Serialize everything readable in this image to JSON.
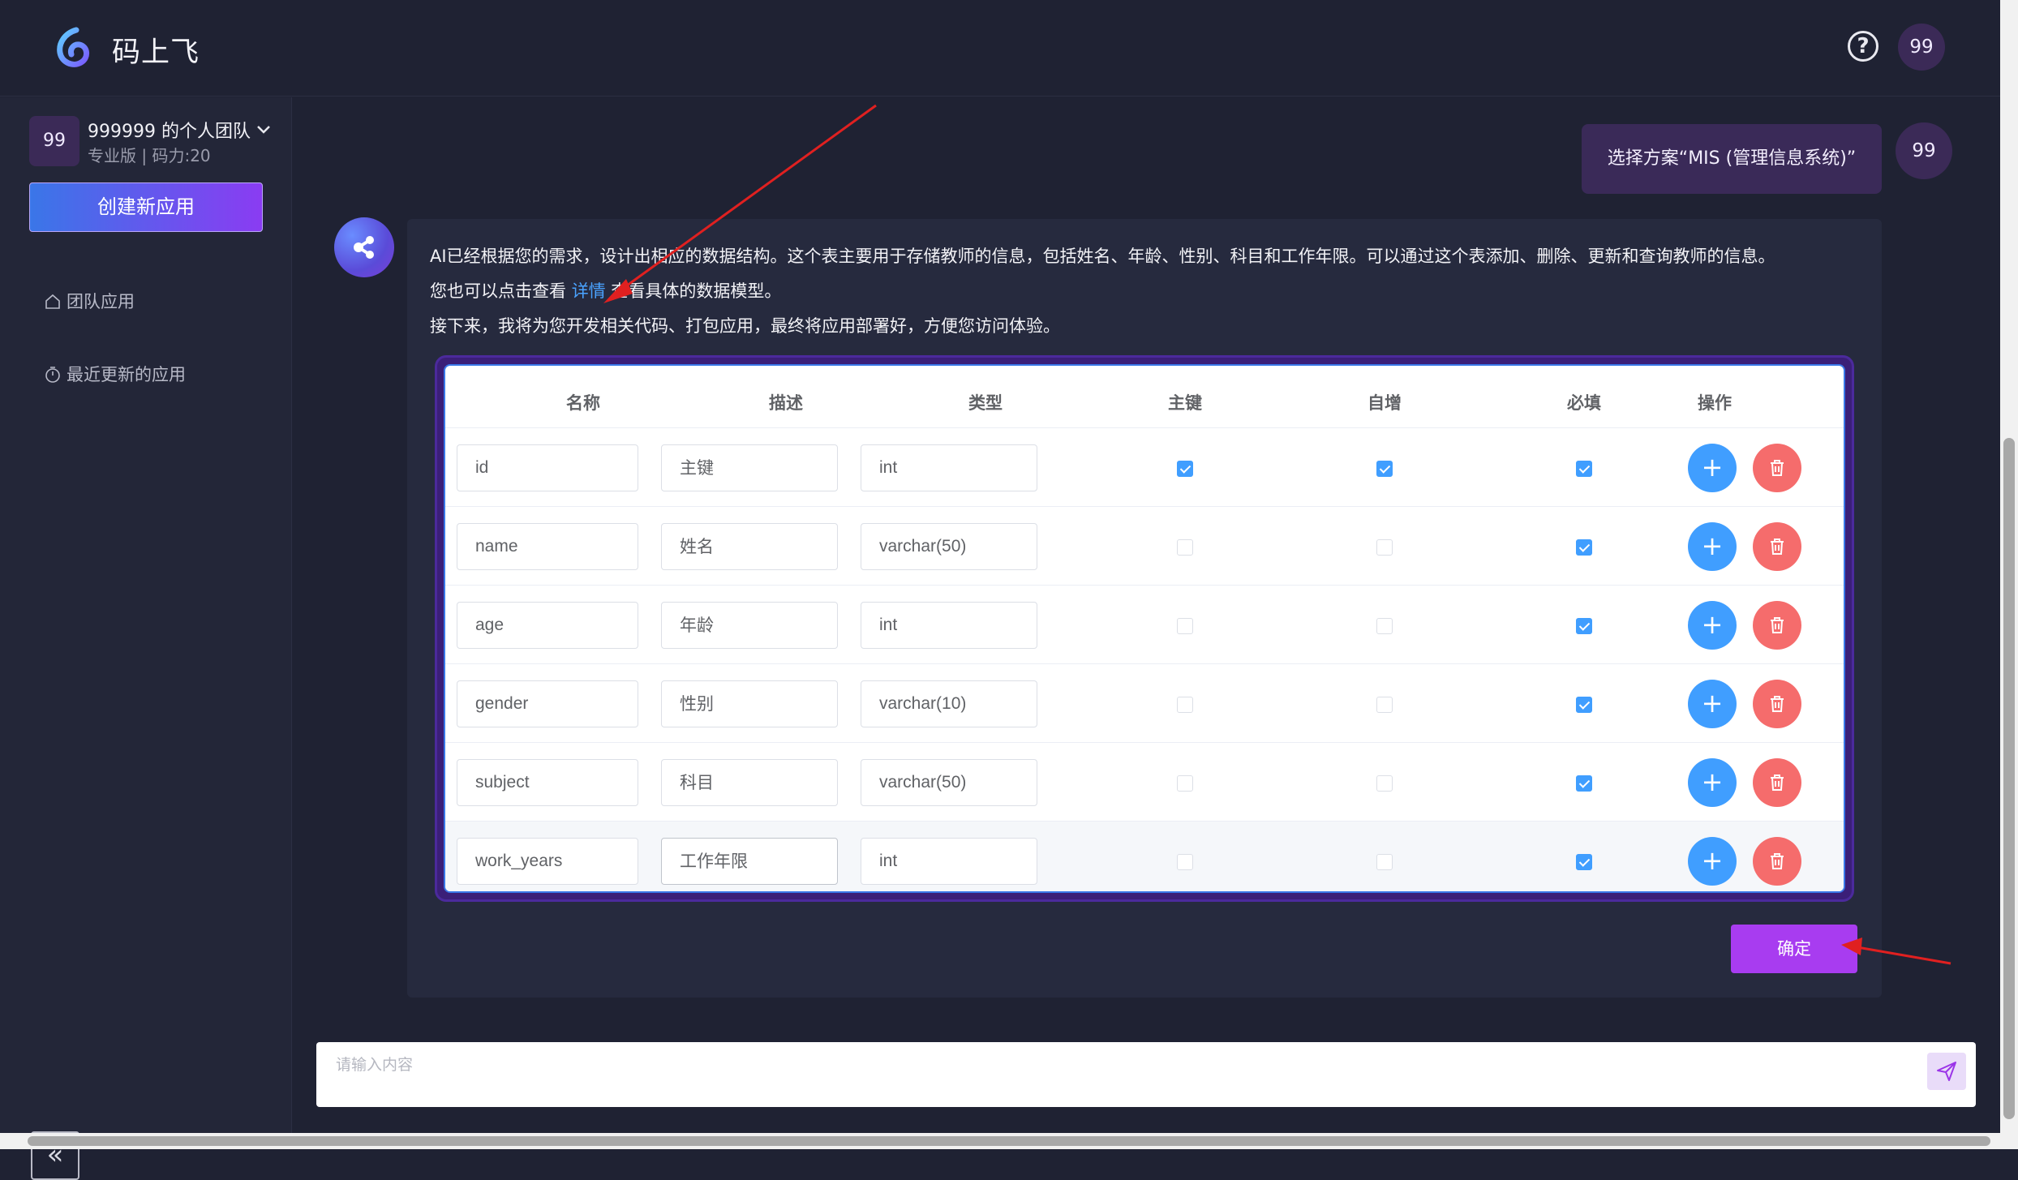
{
  "header": {
    "app_name": "码上飞",
    "help_icon": "question-circle-icon",
    "avatar_text": "99"
  },
  "sidebar": {
    "team": {
      "avatar_text": "99",
      "name": "999999 的个人团队",
      "subtitle": "专业版 | 码力:20"
    },
    "create_button": "创建新应用",
    "nav": [
      {
        "icon": "home-icon",
        "label": "团队应用"
      },
      {
        "icon": "stopwatch-icon",
        "label": "最近更新的应用"
      }
    ],
    "collapse_icon": "double-chevron-left-icon",
    "collapse_glyph": "«"
  },
  "chat": {
    "user_message": "选择方案“MIS (管理信息系统)”",
    "user_avatar": "99",
    "ai_line1": "AI已经根据您的需求，设计出相应的数据结构。这个表主要用于存储教师的信息，包括姓名、年龄、性别、科目和工作年限。可以通过这个表添加、删除、更新和查询教师的信息。",
    "ai_line2_prefix": "您也可以点击查看 ",
    "ai_line2_link": "详情",
    "ai_line2_suffix": " 查看具体的数据模型。",
    "ai_line3": "接下来，我将为您开发相关代码、打包应用，最终将应用部署好，方便您访问体验。"
  },
  "table": {
    "headers": {
      "name": "名称",
      "desc": "描述",
      "type": "类型",
      "pk": "主键",
      "auto": "自增",
      "required": "必填",
      "ops": "操作"
    },
    "rows": [
      {
        "name": "id",
        "desc": "主键",
        "type": "int",
        "pk": true,
        "auto": true,
        "required": true
      },
      {
        "name": "name",
        "desc": "姓名",
        "type": "varchar(50)",
        "pk": false,
        "auto": false,
        "required": true
      },
      {
        "name": "age",
        "desc": "年龄",
        "type": "int",
        "pk": false,
        "auto": false,
        "required": true
      },
      {
        "name": "gender",
        "desc": "性别",
        "type": "varchar(10)",
        "pk": false,
        "auto": false,
        "required": true
      },
      {
        "name": "subject",
        "desc": "科目",
        "type": "varchar(50)",
        "pk": false,
        "auto": false,
        "required": true
      },
      {
        "name": "work_years",
        "desc": "工作年限",
        "type": "int",
        "pk": false,
        "auto": false,
        "required": true
      }
    ],
    "add_glyph": "+",
    "add_icon": "plus-icon",
    "delete_icon": "trash-icon"
  },
  "confirm_button": "确定",
  "input": {
    "placeholder": "请输入内容",
    "send_icon": "send-icon"
  },
  "colors": {
    "background": "#1f2233",
    "sidebar": "#232638",
    "accent_purple": "#a83cf0",
    "checkbox_blue": "#409eff",
    "delete_red": "#f56c6c",
    "annotation_red": "#e02020"
  }
}
